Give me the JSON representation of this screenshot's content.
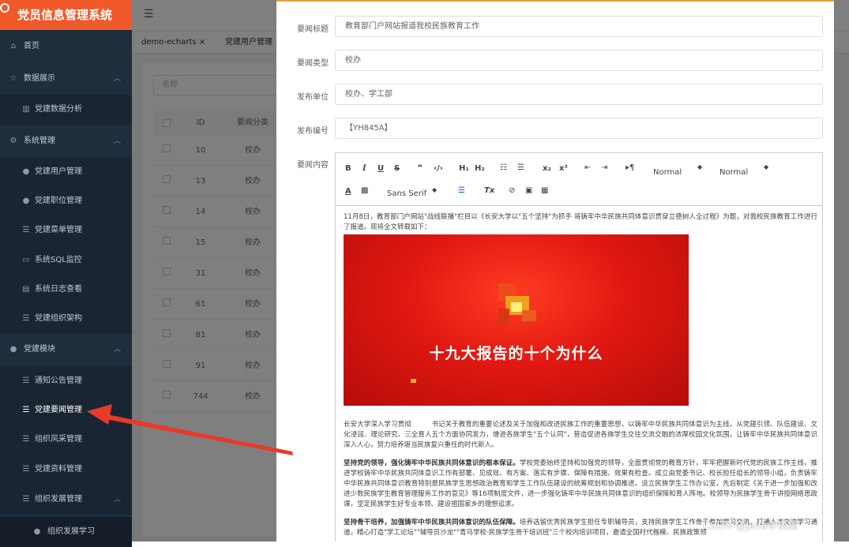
{
  "sidebar": {
    "title": "党员信息管理系统",
    "items": [
      {
        "label": "首页",
        "icon": "home-icon"
      },
      {
        "label": "数据展示",
        "icon": "star-icon"
      },
      {
        "label": "党建数据分析",
        "icon": "bar-chart-icon"
      },
      {
        "label": "系统管理",
        "icon": "gear-icon"
      },
      {
        "label": "党建用户管理",
        "icon": "user-icon"
      },
      {
        "label": "党建职位管理",
        "icon": "user-tie-icon"
      },
      {
        "label": "党建菜单管理",
        "icon": "list-icon"
      },
      {
        "label": "系统SQL监控",
        "icon": "monitor-icon"
      },
      {
        "label": "系统日志查看",
        "icon": "document-icon"
      },
      {
        "label": "党建组织架构",
        "icon": "list-icon"
      },
      {
        "label": "党建模块",
        "icon": "user-icon"
      },
      {
        "label": "通知公告管理",
        "icon": "list-icon"
      },
      {
        "label": "党建要闻管理",
        "icon": "list-icon"
      },
      {
        "label": "组织风采管理",
        "icon": "list-icon"
      },
      {
        "label": "党建资料管理",
        "icon": "list-icon"
      },
      {
        "label": "组织发展管理",
        "icon": "list-icon"
      },
      {
        "label": "组织发展学习",
        "icon": "location-pin-icon"
      }
    ]
  },
  "tabs": [
    "demo-echarts",
    "党建用户管理"
  ],
  "table": {
    "search_placeholder": "名称",
    "columns": [
      "ID",
      "要闻分类"
    ],
    "rows": [
      {
        "id": "10",
        "category": "校办"
      },
      {
        "id": "13",
        "category": "校办"
      },
      {
        "id": "14",
        "category": "校办"
      },
      {
        "id": "15",
        "category": "校办"
      },
      {
        "id": "31",
        "category": "校办"
      },
      {
        "id": "61",
        "category": "校办"
      },
      {
        "id": "81",
        "category": "校办"
      },
      {
        "id": "91",
        "category": "校办"
      },
      {
        "id": "744",
        "category": "校办"
      }
    ]
  },
  "form": {
    "title_label": "要闻标题",
    "title_value": "教育部门户网站报道我校民族教育工作",
    "type_label": "要闻类型",
    "type_value": "校办",
    "unit_label": "发布单位",
    "unit_value": "校办、学工部",
    "number_label": "发布编号",
    "number_value": "【YH845A】",
    "content_label": "要闻内容"
  },
  "editor": {
    "header_select_1": "Normal",
    "header_select_2": "Normal",
    "font_select": "Sans Serif",
    "para1": "11月8日，教育部门户网站\"战线联播\"栏目以《长安大学以\"五个坚持\"为抓手 将铸牢中华民族共同体意识贯穿立德树人全过程》为题，对我校民族教育工作进行了报道。现将全文转载如下：",
    "banner_text": "十九大报告的十个为什么",
    "para2": "长安大学深入学习贯彻　　　书记关于教育的重要论述及关于加强和改进民族工作的重要思想，以铸牢中华民族共同体意识为主线，从党建引领、队伍建设、文化浸润、理论研究、三全育人五个方面协同发力，增进各族学生\"五个认同\"，营造促进各族学生交往交流交融的浓厚校园文化氛围，让铸牢中华民族共同体意识深入人心，努力培养堪当民族复兴重任的时代新人。",
    "para3_bold": "坚持党的领导，强化铸牢中华民族共同体意识的根本保证。",
    "para3": "学校党委始终坚持和加强党的领导，全面贯彻党的教育方针，牢牢把握新时代党的民族工作主线，推进学校铸牢中华民族共同体意识工作有部署、见成效、有方案、落实有步骤、保障有措施、效果有检查。成立由党委书记、校长担任组长的领导小组，负责铸牢中华民族共同体意识教育特别是民族学生思想政治教育和学生工作队伍建设的统筹规划和协调推进。设立民族学生工作办公室，先后制定《关于进一步加强和改进少数民族学生教育管理服务工作的意见》等16项制度文件，进一步强化铸牢中华民族共同体意识的组织保障和育人阵地。校领导为民族学生骨干讲授网络思政课，坚定民族学生好专业本领、建设祖国家乡的理想追求。",
    "para4_bold": "坚持骨干培养，加强铸牢中华民族共同体意识的队伍保障。",
    "para4": "培养选留优秀民族学生担任专职辅导员，支持民族学生工作骨干参加学习交流，打通人才交流学习通道，精心打造\"学工论坛\"\"辅导员沙龙\"\"青马学校·民族学生骨干培训班\"三个校内培训项目，邀请全国时代楷模、民族政策领"
  },
  "watermark": "CSDN @java李杨勇",
  "colors": {
    "accent": "#f05a2a",
    "sidebar_bg": "#1f2d3d",
    "drawer_border": "#e6a23c",
    "arrow": "#e83a2a"
  }
}
